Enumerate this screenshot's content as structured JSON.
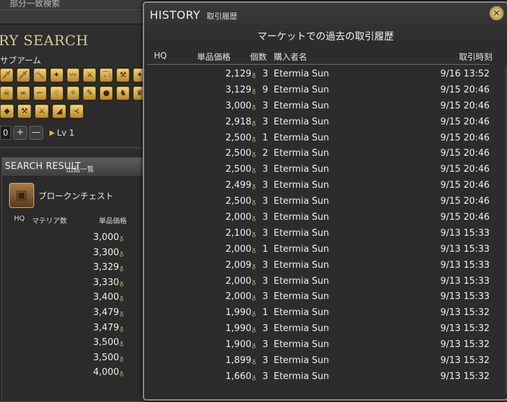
{
  "background": {
    "top_text": "部分一致検索",
    "title": "RY SEARCH",
    "subcategory_label": "サブアーム",
    "icon_rows": [
      [
        "🗡",
        "🗡",
        "🔨",
        "✦",
        "〰",
        "⚔",
        "🏹",
        "⚒",
        "✦"
      ],
      [
        "☠",
        "∞",
        "⌐",
        "♢",
        "✧",
        "✎",
        "●",
        "♞",
        "♛"
      ],
      [
        "◆",
        "⚒",
        "⚔",
        "◢",
        "≺"
      ]
    ],
    "level": {
      "value": "0",
      "plus": "+",
      "minus": "—",
      "label": "Lv 1"
    }
  },
  "search_result": {
    "title": "SEARCH RESULT",
    "subtitle": "出品一覧",
    "item_name": "ブロークンチェスト",
    "columns": {
      "hq": "HQ",
      "materia": "マテリア数",
      "price": "単品価格"
    },
    "prices": [
      "3,000",
      "3,300",
      "3,329",
      "3,330",
      "3,400",
      "3,479",
      "3,479",
      "3,500",
      "3,500",
      "4,000"
    ],
    "gil_symbol": "ᵹ"
  },
  "history": {
    "title": "HISTORY",
    "title_jp": "取引履歴",
    "subtitle": "マーケットでの過去の取引履歴",
    "columns": {
      "hq": "HQ",
      "price": "単品価格",
      "qty": "個数",
      "buyer": "購入者名",
      "date": "取引時刻"
    },
    "rows": [
      {
        "price": "2,129",
        "qty": "3",
        "buyer": "Etermia Sun",
        "date": "9/16 13:52"
      },
      {
        "price": "3,129",
        "qty": "9",
        "buyer": "Etermia Sun",
        "date": "9/15 20:46"
      },
      {
        "price": "3,000",
        "qty": "3",
        "buyer": "Etermia Sun",
        "date": "9/15 20:46"
      },
      {
        "price": "2,918",
        "qty": "3",
        "buyer": "Etermia Sun",
        "date": "9/15 20:46"
      },
      {
        "price": "2,500",
        "qty": "1",
        "buyer": "Etermia Sun",
        "date": "9/15 20:46"
      },
      {
        "price": "2,500",
        "qty": "2",
        "buyer": "Etermia Sun",
        "date": "9/15 20:46"
      },
      {
        "price": "2,500",
        "qty": "3",
        "buyer": "Etermia Sun",
        "date": "9/15 20:46"
      },
      {
        "price": "2,499",
        "qty": "3",
        "buyer": "Etermia Sun",
        "date": "9/15 20:46"
      },
      {
        "price": "2,500",
        "qty": "3",
        "buyer": "Etermia Sun",
        "date": "9/15 20:46"
      },
      {
        "price": "2,000",
        "qty": "3",
        "buyer": "Etermia Sun",
        "date": "9/15 20:46"
      },
      {
        "price": "2,100",
        "qty": "3",
        "buyer": "Etermia Sun",
        "date": "9/13 15:33"
      },
      {
        "price": "2,000",
        "qty": "1",
        "buyer": "Etermia Sun",
        "date": "9/13 15:33"
      },
      {
        "price": "2,009",
        "qty": "3",
        "buyer": "Etermia Sun",
        "date": "9/13 15:33"
      },
      {
        "price": "2,000",
        "qty": "3",
        "buyer": "Etermia Sun",
        "date": "9/13 15:33"
      },
      {
        "price": "2,000",
        "qty": "3",
        "buyer": "Etermia Sun",
        "date": "9/13 15:33"
      },
      {
        "price": "1,990",
        "qty": "1",
        "buyer": "Etermia Sun",
        "date": "9/13 15:32"
      },
      {
        "price": "1,990",
        "qty": "3",
        "buyer": "Etermia Sun",
        "date": "9/13 15:32"
      },
      {
        "price": "1,900",
        "qty": "3",
        "buyer": "Etermia Sun",
        "date": "9/13 15:32"
      },
      {
        "price": "1,899",
        "qty": "3",
        "buyer": "Etermia Sun",
        "date": "9/13 15:32"
      },
      {
        "price": "1,660",
        "qty": "3",
        "buyer": "Etermia Sun",
        "date": "9/13 15:32"
      }
    ]
  },
  "colors": {
    "accent_gold": "#e6b84a",
    "frame": "#8b8b8b"
  }
}
